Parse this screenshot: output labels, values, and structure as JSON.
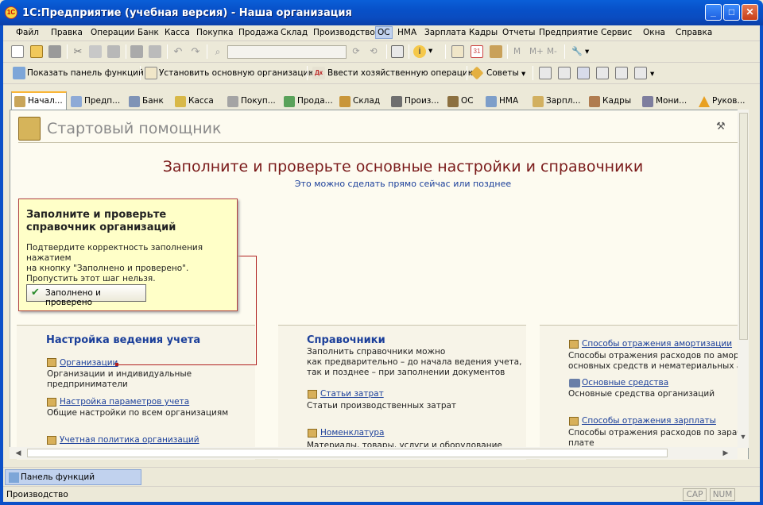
{
  "window": {
    "title": "1С:Предприятие (учебная версия) - Наша организация",
    "icon_text": "1C"
  },
  "menu": [
    "Файл",
    "Правка",
    "Операции",
    "Банк",
    "Касса",
    "Покупка",
    "Продажа",
    "Склад",
    "Производство",
    "ОС",
    "НМА",
    "Зарплата",
    "Кадры",
    "Отчеты",
    "Предприятие",
    "Сервис",
    "Окна",
    "Справка"
  ],
  "toolbar2": {
    "show_panel": "Показать панель функций",
    "set_org": "Установить основную организацию",
    "enter_op": "Ввести хозяйственную операцию",
    "tips": "Советы"
  },
  "toolbar1": {
    "m": "M",
    "mplus": "M+",
    "mminus": "M-",
    "calendar_day": "31"
  },
  "tabs": [
    "Начал...",
    "Предп...",
    "Банк",
    "Касса",
    "Покуп...",
    "Прода...",
    "Склад",
    "Произ...",
    "ОС",
    "НМА",
    "Зарпл...",
    "Кадры",
    "Мони...",
    "Руков..."
  ],
  "helper": {
    "title": "Стартовый помощник",
    "main_heading": "Заполните и проверьте основные настройки и справочники",
    "sub_heading": "Это можно сделать прямо сейчас или позднее"
  },
  "popup": {
    "heading": "Заполните и проверьте справочник организаций",
    "text_line1": "Подтвердите корректность заполнения нажатием",
    "text_line2": "на кнопку \"Заполнено и проверено\".",
    "text_line3": "Пропустить этот шаг нельзя.",
    "button": "Заполнено и проверено"
  },
  "col1": {
    "heading": "Настройка ведения учета",
    "link1": "Организации",
    "desc1a": "Организации и индивидуальные",
    "desc1b": "предприниматели",
    "link2": "Настройка параметров учета",
    "desc2": "Общие настройки по всем организациям",
    "link3": "Учетная политика организаций"
  },
  "col2": {
    "heading": "Справочники",
    "intro1": "Заполнить справочники можно",
    "intro2": "как предварительно – до начала ведения учета,",
    "intro3": "так и позднее – при заполнении документов",
    "link1": "Статьи затрат",
    "desc1": "Статьи производственных затрат",
    "link2": "Номенклатура",
    "desc2": "Материалы, товары, услуги и оборудование"
  },
  "col3": {
    "link1": "Способы отражения амортизации",
    "desc1a": "Способы отражения расходов по амортиз",
    "desc1b": "основных средств и нематериальных акт",
    "link2": "Основные средства",
    "desc2": "Основные средства организаций",
    "link3": "Способы отражения зарплаты",
    "desc3a": "Способы отражения расходов по заработ",
    "desc3b": "плате"
  },
  "panel_button": "Панель функций",
  "status": {
    "text": "Производство",
    "cap": "CAP",
    "num": "NUM"
  }
}
